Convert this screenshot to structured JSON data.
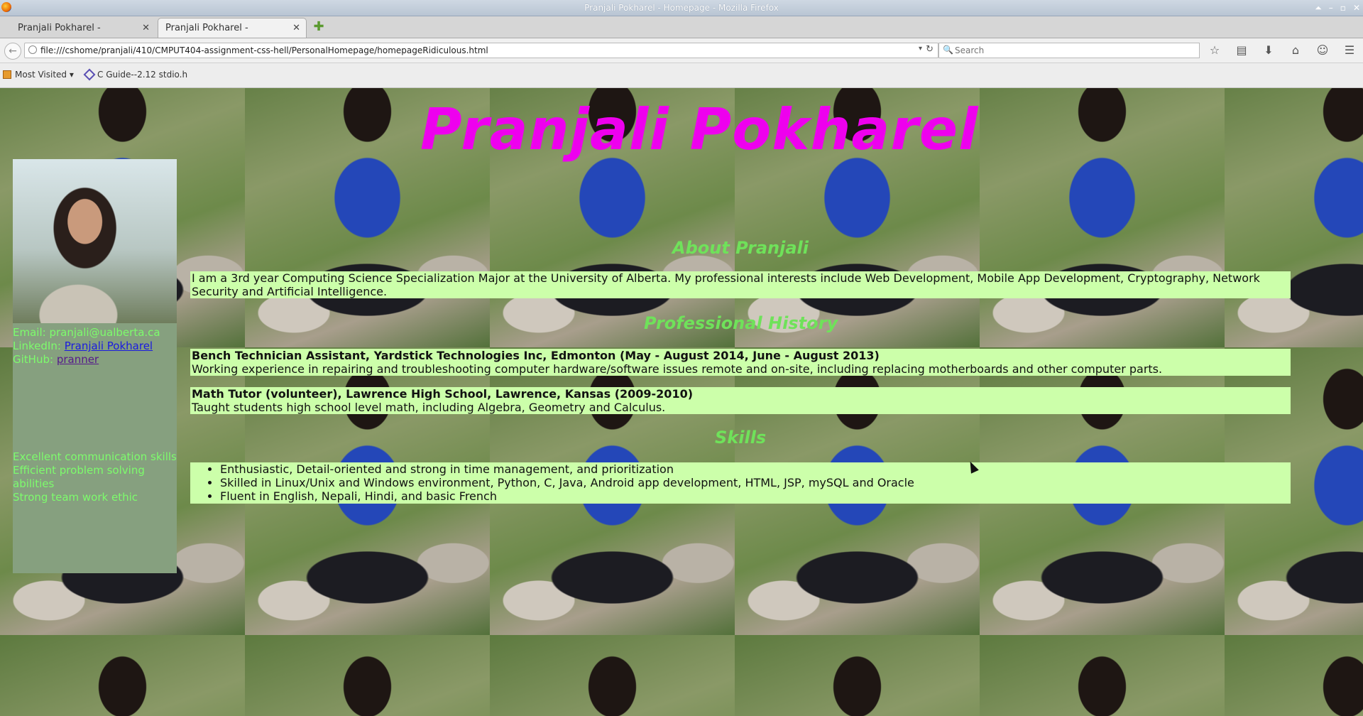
{
  "window": {
    "title": "Pranjali Pokharel - Homepage - Mozilla Firefox",
    "controls": [
      "⏶",
      "–",
      "▫",
      "✕"
    ]
  },
  "tabs": [
    {
      "label": "Pranjali Pokharel - Homepage",
      "close": "✕"
    },
    {
      "label": "Pranjali Pokharel - Homepage",
      "close": "✕"
    }
  ],
  "newtab": "✚",
  "nav": {
    "url": "file:///cshome/pranjali/410/CMPUT404-assignment-css-hell/PersonalHomepage/homepageRidiculous.html",
    "search_placeholder": "Search",
    "back": "←",
    "reload": "↻",
    "dropdown": "▾",
    "search_icon": "🔍",
    "icons": [
      "☆",
      "▤",
      "⬇",
      "⌂",
      "☺",
      "☰"
    ]
  },
  "bookmarks": [
    {
      "label": "Most Visited ▾"
    },
    {
      "label": "C Guide--2.12 stdio.h"
    }
  ],
  "page": {
    "name": "Pranjali Pokharel",
    "contact": {
      "email_prefix": "Email: ",
      "email": "pranjali@ualberta.ca",
      "linkedin_prefix": "LinkedIn: ",
      "linkedin": "Pranjali Pokharel",
      "github_prefix": "GitHub: ",
      "github": "pranner"
    },
    "traits": [
      "Excellent communication skills",
      "Efficient problem solving abilities",
      "Strong team work ethic"
    ],
    "about_heading": "About Pranjali",
    "about_text": "I am a 3rd year Computing Science Specialization Major at the University of Alberta. My professional interests include Web Development, Mobile App Development, Cryptography, Network Security and Artificial Intelligence.",
    "prof_heading": "Professional History",
    "jobs": [
      {
        "title": "Bench Technician Assistant, Yardstick Technologies Inc, Edmonton (May - August 2014, June - August 2013)",
        "desc": "Working experience in repairing and troubleshooting computer hardware/software issues remote and on-site, including replacing motherboards and other computer parts."
      },
      {
        "title": "Math Tutor (volunteer), Lawrence High School, Lawrence, Kansas (2009-2010)",
        "desc": "Taught students high school level math, including Algebra, Geometry and Calculus."
      }
    ],
    "skills_heading": "Skills",
    "skills": [
      "Enthusiastic, Detail-oriented and strong in time management, and prioritization",
      "Skilled in Linux/Unix and Windows environment, Python, C, Java, Android app development, HTML, JSP, mySQL and Oracle",
      "Fluent in English, Nepali, Hindi, and basic French"
    ]
  }
}
